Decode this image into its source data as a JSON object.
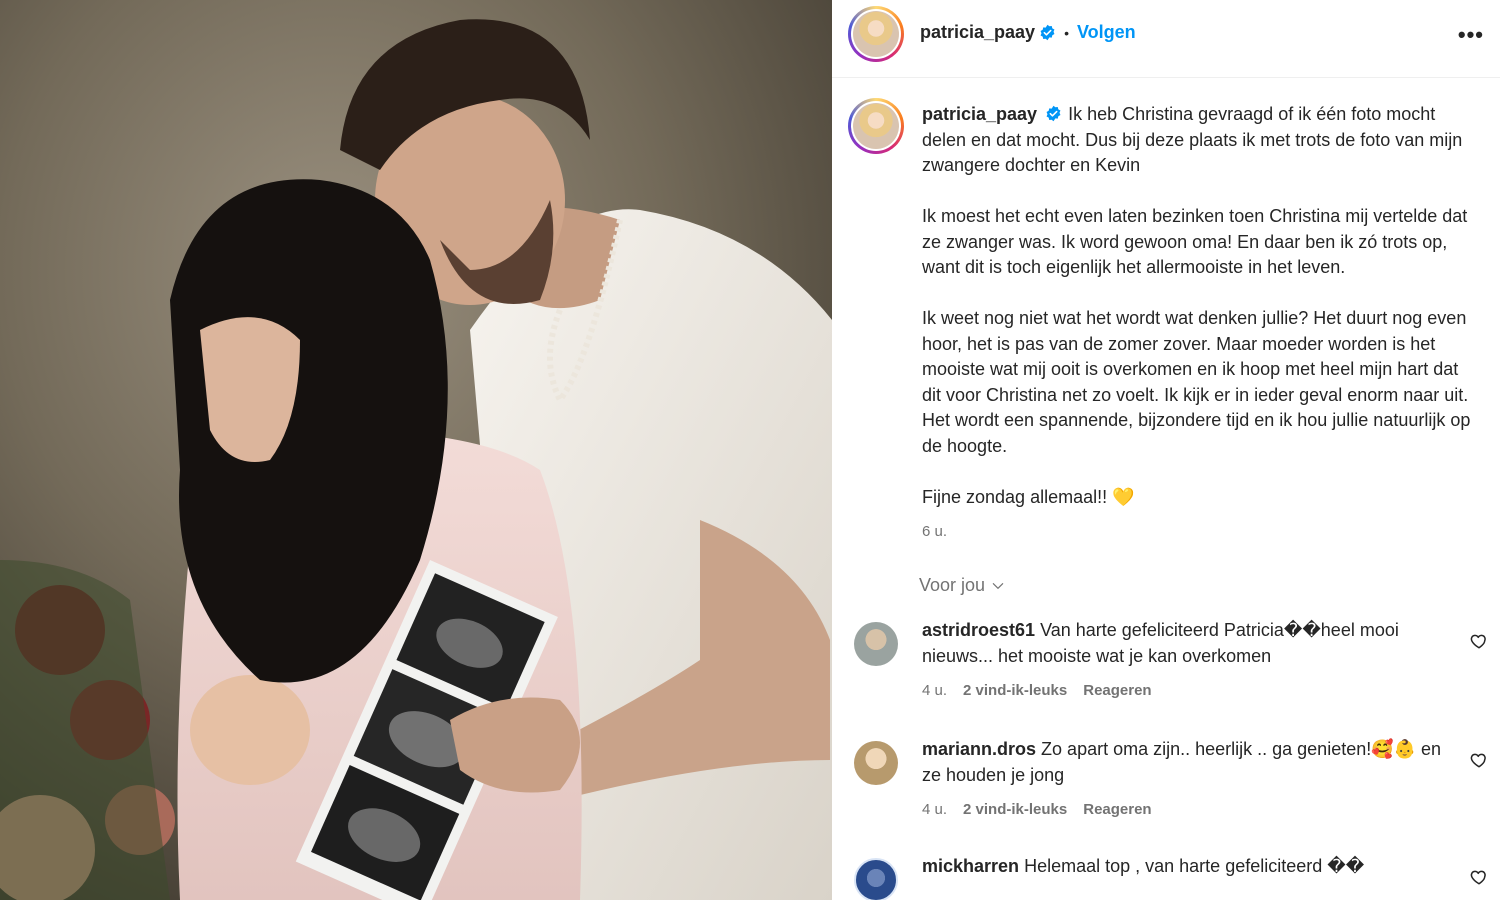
{
  "post": {
    "username": "patricia_paay",
    "follow_label": "Volgen",
    "separator": "•",
    "more_label": "•••"
  },
  "caption": {
    "username": "patricia_paay",
    "paragraphs": [
      "Ik heb Christina gevraagd of ik één foto mocht delen en dat mocht. Dus bij deze plaats ik met trots de foto van mijn zwangere dochter en Kevin",
      "Ik moest het echt even laten bezinken toen Christina mij vertelde dat ze zwanger was. Ik word gewoon oma! En daar ben ik zó trots op, want dit is toch eigenlijk het allermooiste in het leven.",
      "Ik weet nog niet wat het wordt wat denken jullie? Het duurt nog even hoor, het is pas van de zomer zover. Maar moeder worden is het mooiste wat mij ooit is overkomen en ik hoop met heel mijn hart dat dit voor Christina net zo voelt. Ik kijk er in ieder geval enorm naar uit. Het wordt een spannende, bijzondere tijd en ik hou jullie natuurlijk op de hoogte."
    ],
    "closing": "Fijne zondag allemaal!!",
    "closing_emoji": "💛",
    "timestamp": "6 u."
  },
  "for_you_label": "Voor jou",
  "comments": [
    {
      "username": "astridroest61",
      "text": "Van harte gefeliciteerd Patricia��heel mooi nieuws... het mooiste wat je kan overkomen",
      "time": "4 u.",
      "likes": "2 vind-ik-leuks",
      "reply": "Reageren",
      "avatar_color": "#9aa3a0"
    },
    {
      "username": "mariann.dros",
      "text": "Zo apart oma zijn.. heerlijk .. ga genieten!🥰👶 en ze houden je jong",
      "time": "4 u.",
      "likes": "2 vind-ik-leuks",
      "reply": "Reageren",
      "avatar_color": "#b79a6d"
    },
    {
      "username": "mickharren",
      "text": "Helemaal top , van harte gefeliciteerd ��",
      "avatar_color": "#2a4b8c"
    }
  ],
  "colors": {
    "link_blue": "#0095f6",
    "verified_blue": "#0095f6",
    "muted": "#737373",
    "text": "#262626"
  },
  "icons": [
    "verified-icon",
    "more-icon",
    "chevron-down-icon",
    "heart-outline-icon"
  ]
}
